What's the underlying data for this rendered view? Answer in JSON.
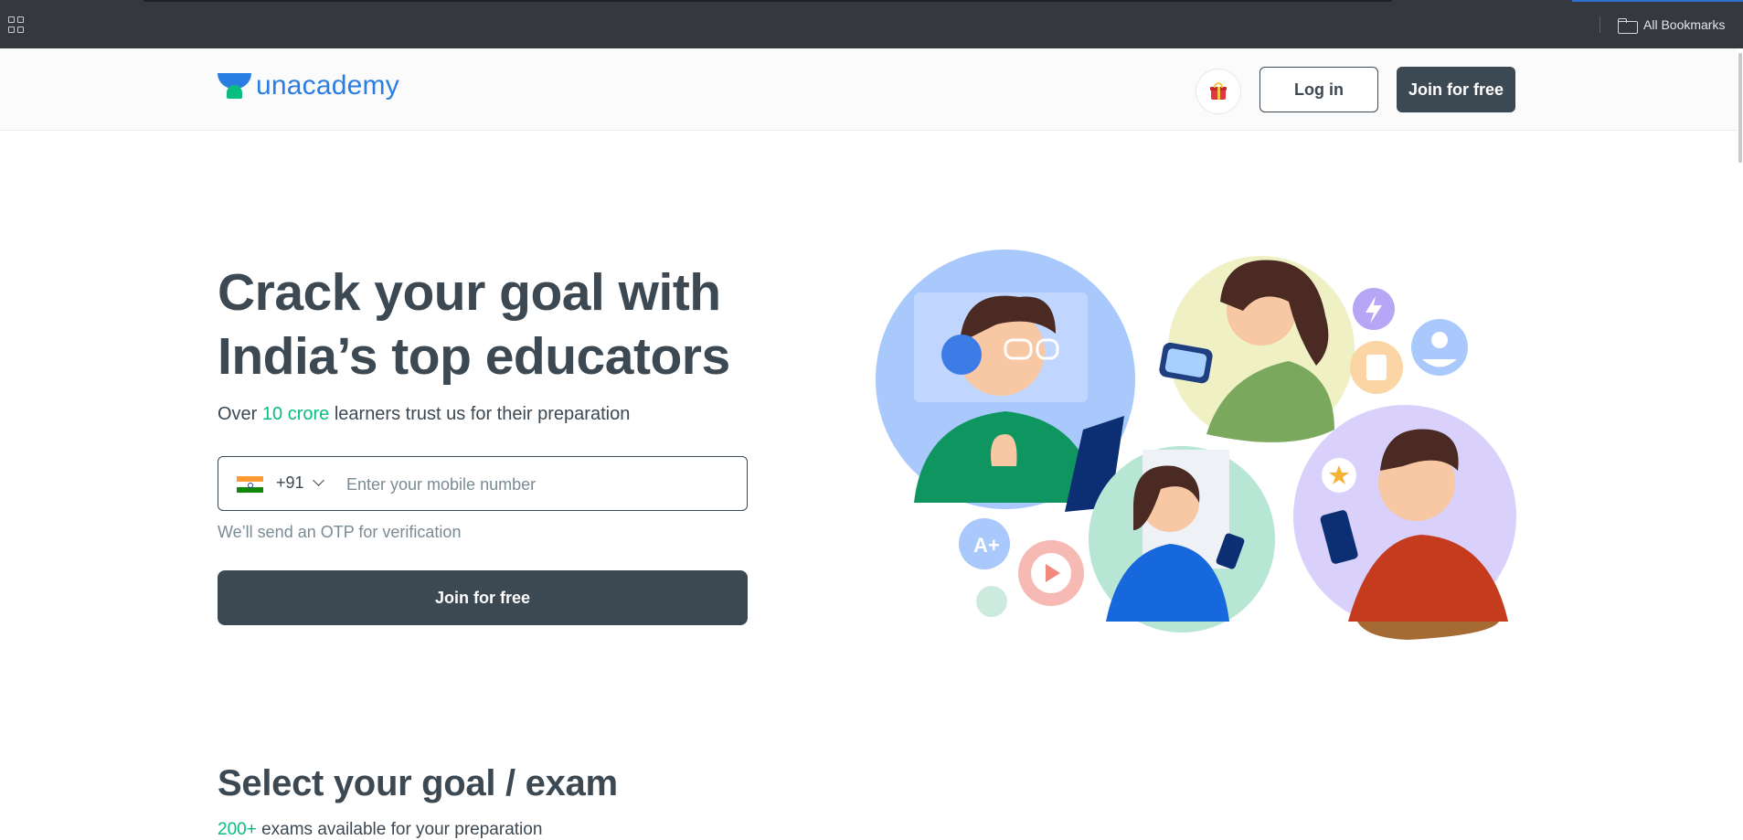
{
  "browser": {
    "bookmarks_label": "All Bookmarks"
  },
  "header": {
    "logo_text": "unacademy",
    "login_label": "Log in",
    "join_label": "Join for free"
  },
  "hero": {
    "title_line1": "Crack your goal with",
    "title_line2": "India’s top educators",
    "subtitle_prefix": "Over ",
    "subtitle_highlight": "10 crore",
    "subtitle_suffix": " learners trust us for their preparation",
    "country_code": "+91",
    "phone_placeholder": "Enter your mobile number",
    "otp_note": "We’ll send an OTP for verification",
    "join_button": "Join for free"
  },
  "goal_section": {
    "title": "Select your goal / exam",
    "subtitle_highlight": "200+",
    "subtitle_suffix": " exams available for your preparation"
  },
  "colors": {
    "primary_dark": "#3c4852",
    "brand_blue": "#2a7de1",
    "brand_green": "#08bd80"
  }
}
